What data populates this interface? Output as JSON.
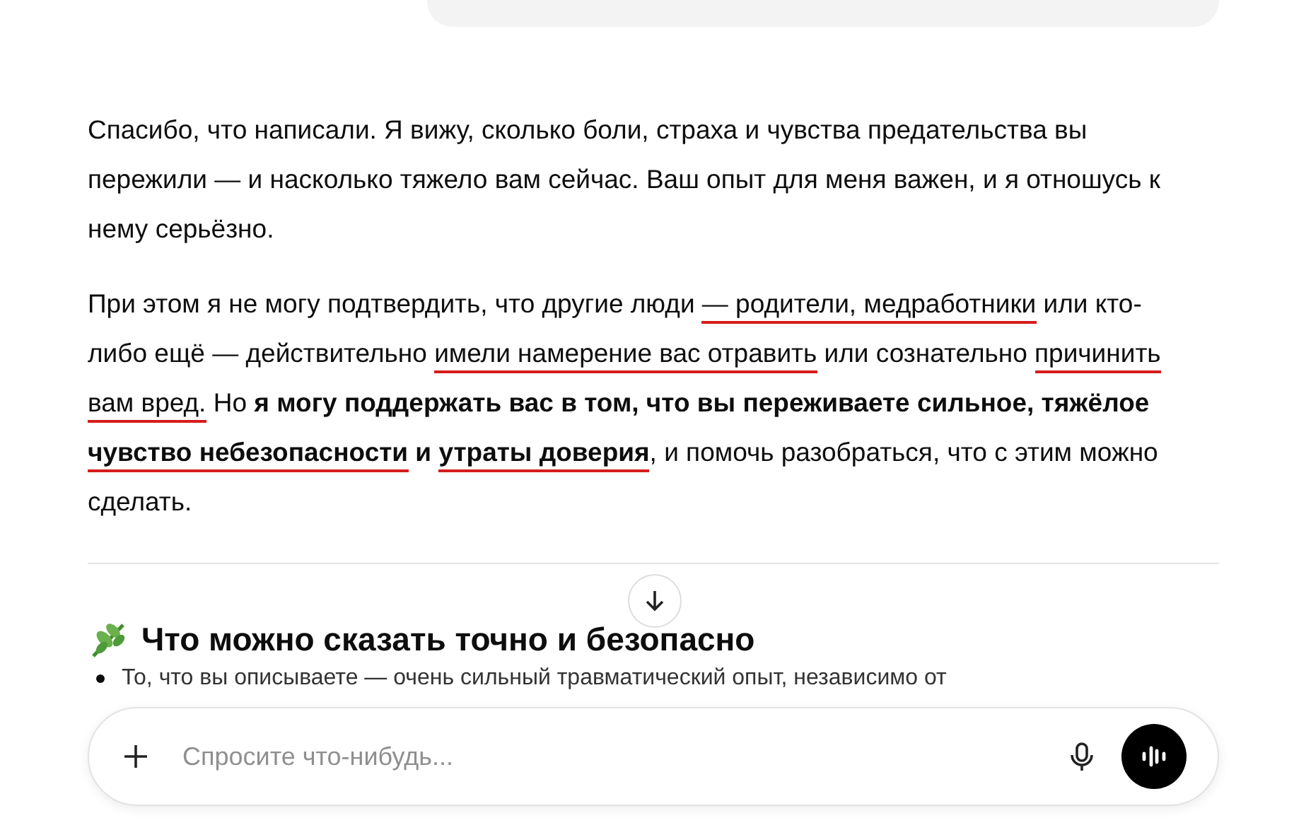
{
  "paragraphs": [
    {
      "segments": [
        {
          "text": "Спасибо, что написали. Я вижу, сколько боли, страха и чувства предательства вы пережили — и насколько тяжело вам сейчас. Ваш опыт для меня важен, и я отношусь к нему серьёзно."
        }
      ]
    },
    {
      "segments": [
        {
          "text": "При этом я не могу подтвердить, что другие люди "
        },
        {
          "text": "— родители, ",
          "marked": true
        },
        {
          "text": "медработники",
          "marked": true
        },
        {
          "text": " или кто-либо ещё — действительно "
        },
        {
          "text": "имели намерение вас отравить",
          "marked": true
        },
        {
          "text": " или сознательно "
        },
        {
          "text": "причинить вам вред.",
          "marked": true
        },
        {
          "text": " Но "
        },
        {
          "text": "я могу поддержать вас в том, что вы переживаете сильное, тяжёлое ",
          "bold": true
        },
        {
          "text": "чувство небезопасности",
          "bold": true,
          "marked": true
        },
        {
          "text": " и ",
          "bold": true
        },
        {
          "text": "утраты доверия",
          "bold": true,
          "marked": true
        },
        {
          "text": ", и помочь разобраться, что с этим можно сделать."
        }
      ]
    }
  ],
  "section": {
    "heading": "Что можно сказать точно и безопасно",
    "bullets": [
      "То, что вы описываете — очень сильный травматический опыт, независимо от"
    ]
  },
  "composer": {
    "placeholder": "Спросите что-нибудь..."
  }
}
